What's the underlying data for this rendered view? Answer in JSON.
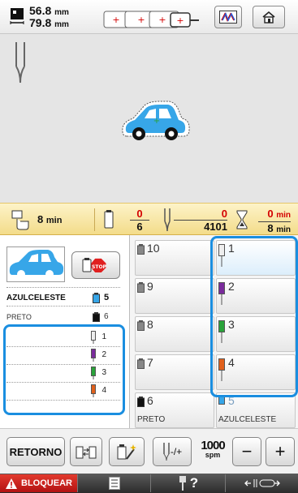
{
  "topbar": {
    "width_value": "56.8",
    "height_value": "79.8",
    "unit": "mm",
    "buttons": [
      "hoop-select",
      "color-palette",
      "home"
    ]
  },
  "status": {
    "time_total": "8",
    "time_unit": "min",
    "color_current": "0",
    "color_total": "6",
    "stitch_current": "0",
    "stitch_total": "4101",
    "remaining_current": "0",
    "remaining_total": "8",
    "remaining_unit": "min"
  },
  "current_thread": {
    "name": "AZULCELESTE",
    "number": "5",
    "next_name": "PRETO",
    "next_number": "6",
    "sequence": [
      "1",
      "2",
      "3",
      "4"
    ]
  },
  "grid": {
    "left": [
      {
        "num": "10",
        "name": ""
      },
      {
        "num": "9",
        "name": ""
      },
      {
        "num": "8",
        "name": ""
      },
      {
        "num": "7",
        "name": ""
      },
      {
        "num": "6",
        "name": "PRETO"
      }
    ],
    "right": [
      {
        "num": "1",
        "name": ""
      },
      {
        "num": "2",
        "name": ""
      },
      {
        "num": "3",
        "name": ""
      },
      {
        "num": "4",
        "name": ""
      },
      {
        "num": "5",
        "name": "AZULCELESTE"
      }
    ]
  },
  "toolbar": {
    "retorno_label": "RETORNO",
    "speed_value": "1000",
    "speed_unit": "spm",
    "minus_label": "−",
    "plus_label": "+",
    "tension_label": "-/+"
  },
  "footer": {
    "lock_label": "BLOQUEAR",
    "help_label": "?"
  },
  "colors": {
    "blue": "#1a8ee0",
    "yellow": "#f3dc8a",
    "red": "#d40000",
    "thread_purple": "#7a2b9c",
    "thread_green": "#2aa33a",
    "thread_orange": "#e0601c",
    "thread_sky": "#37a6e8"
  }
}
